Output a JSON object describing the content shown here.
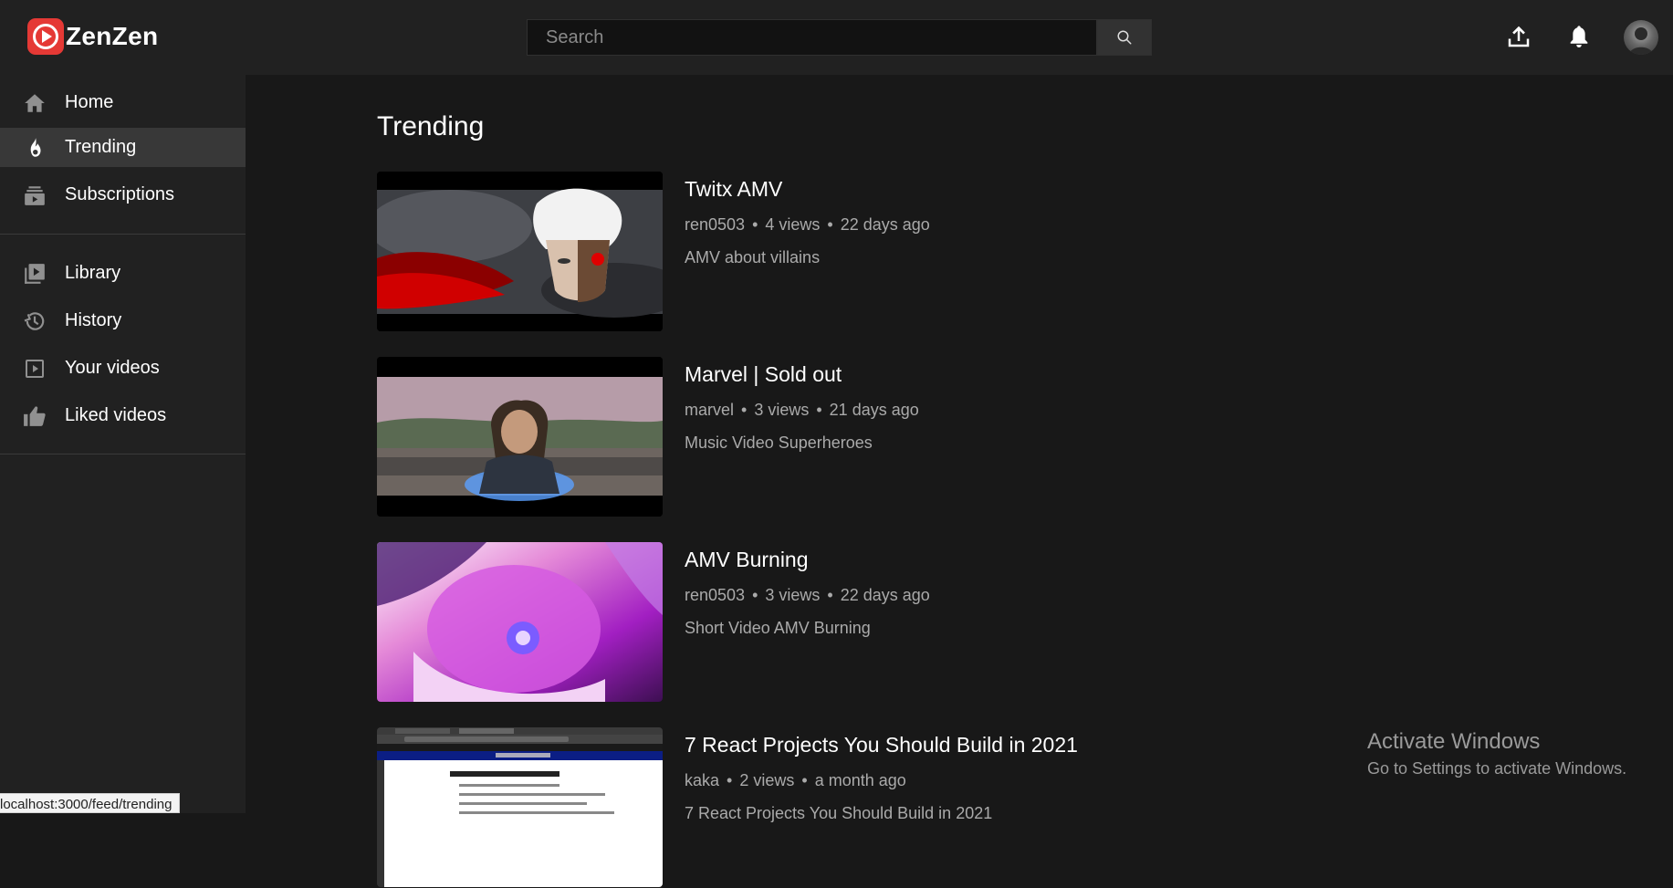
{
  "app": {
    "name": "ZenZen"
  },
  "search": {
    "placeholder": "Search"
  },
  "header": {
    "icons": [
      "upload-icon",
      "bell-icon",
      "avatar"
    ]
  },
  "sidebar": {
    "items": [
      {
        "label": "Home",
        "icon": "home-icon",
        "active": false
      },
      {
        "label": "Trending",
        "icon": "fire-icon",
        "active": true
      },
      {
        "label": "Subscriptions",
        "icon": "subscriptions-icon",
        "active": false
      },
      {
        "label": "Library",
        "icon": "library-icon",
        "active": false
      },
      {
        "label": "History",
        "icon": "history-icon",
        "active": false
      },
      {
        "label": "Your videos",
        "icon": "your-videos-icon",
        "active": false
      },
      {
        "label": "Liked videos",
        "icon": "thumbs-up-icon",
        "active": false
      }
    ]
  },
  "main": {
    "title": "Trending",
    "videos": [
      {
        "title": "Twitx AMV",
        "channel": "ren0503",
        "views": "4 views",
        "age": "22 days ago",
        "description": "AMV about villains"
      },
      {
        "title": "Marvel | Sold out",
        "channel": "marvel",
        "views": "3 views",
        "age": "21 days ago",
        "description": "Music Video Superheroes"
      },
      {
        "title": "AMV Burning",
        "channel": "ren0503",
        "views": "3 views",
        "age": "22 days ago",
        "description": "Short Video AMV Burning"
      },
      {
        "title": "7 React Projects You Should Build in 2021",
        "channel": "kaka",
        "views": "2 views",
        "age": "a month ago",
        "description": "7 React Projects You Should Build in 2021"
      }
    ]
  },
  "watermark": {
    "title": "Activate Windows",
    "subtitle": "Go to Settings to activate Windows."
  },
  "statusbar": {
    "url": "localhost:3000/feed/trending"
  },
  "colors": {
    "background": "#181818",
    "header": "#212121",
    "sidebar_active": "#383838",
    "text_secondary": "#aaaaaa",
    "brand": "#e53935"
  },
  "dot": "•"
}
